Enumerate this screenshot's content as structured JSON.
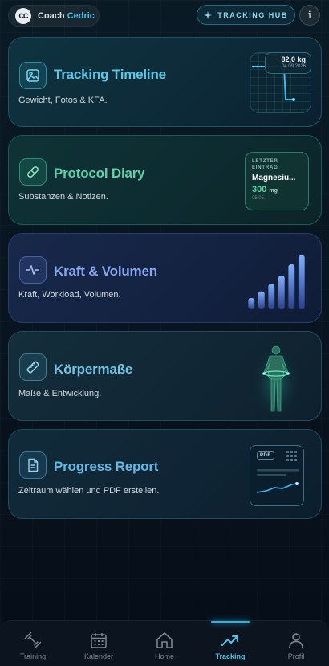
{
  "header": {
    "coach_logo": "CC",
    "coach_prefix": "Coach",
    "coach_name": "Cedric",
    "hub_label": "TRACKING HUB",
    "info_label": "i"
  },
  "cards": [
    {
      "title": "Tracking Timeline",
      "subtitle": "Gewicht, Fotos & KFA.",
      "icon": "image-icon",
      "accent": "#5cc6e6",
      "preview": {
        "weight": "82,0 kg",
        "date": "04.09.2026"
      }
    },
    {
      "title": "Protocol Diary",
      "subtitle": "Substanzen & Notizen.",
      "icon": "pill-icon",
      "accent": "#5fd1a9",
      "preview": {
        "label_line1": "LETZTER",
        "label_line2": "EINTRAG",
        "name": "Magnesiu...",
        "amount": "300",
        "unit": "mg",
        "date": "05.05."
      }
    },
    {
      "title": "Kraft & Volumen",
      "subtitle": "Kraft, Workload, Volumen.",
      "icon": "activity-icon",
      "accent": "#89a6f0",
      "preview": {
        "bar_levels": [
          0.2,
          0.32,
          0.45,
          0.6,
          0.8,
          0.96
        ]
      }
    },
    {
      "title": "Körpermaße",
      "subtitle": "Maße & Entwicklung.",
      "icon": "ruler-icon",
      "accent": "#72c4e4"
    },
    {
      "title": "Progress Report",
      "subtitle": "Zeitraum wählen und PDF erstellen.",
      "icon": "document-icon",
      "accent": "#63b8e6",
      "preview": {
        "tag": "PDF"
      }
    }
  ],
  "nav": [
    {
      "label": "Training",
      "icon": "dumbbell-icon",
      "active": false
    },
    {
      "label": "Kalender",
      "icon": "calendar-icon",
      "active": false
    },
    {
      "label": "Home",
      "icon": "home-icon",
      "active": false
    },
    {
      "label": "Tracking",
      "icon": "trending-up-icon",
      "active": true
    },
    {
      "label": "Profil",
      "icon": "user-icon",
      "active": false
    }
  ]
}
